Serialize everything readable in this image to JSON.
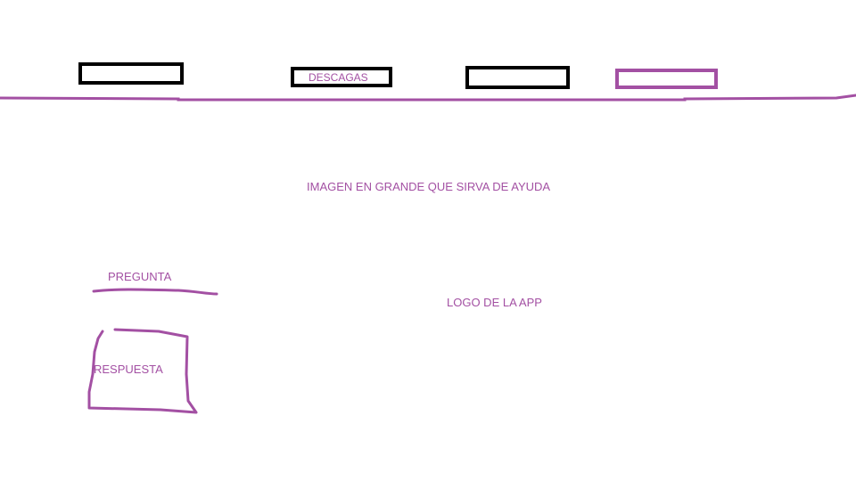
{
  "colors": {
    "accent": "#a350a3",
    "box_border": "#000000",
    "background": "#ffffff"
  },
  "nav": {
    "items": [
      {
        "label": ""
      },
      {
        "label": "DESCAGAS"
      },
      {
        "label": ""
      },
      {
        "label": ""
      }
    ]
  },
  "hero": {
    "text": "IMAGEN EN GRANDE QUE SIRVA DE AYUDA"
  },
  "question": {
    "label": "PREGUNTA"
  },
  "answer": {
    "label": "RESPUESTA"
  },
  "logo": {
    "text": "LOGO DE LA APP"
  }
}
